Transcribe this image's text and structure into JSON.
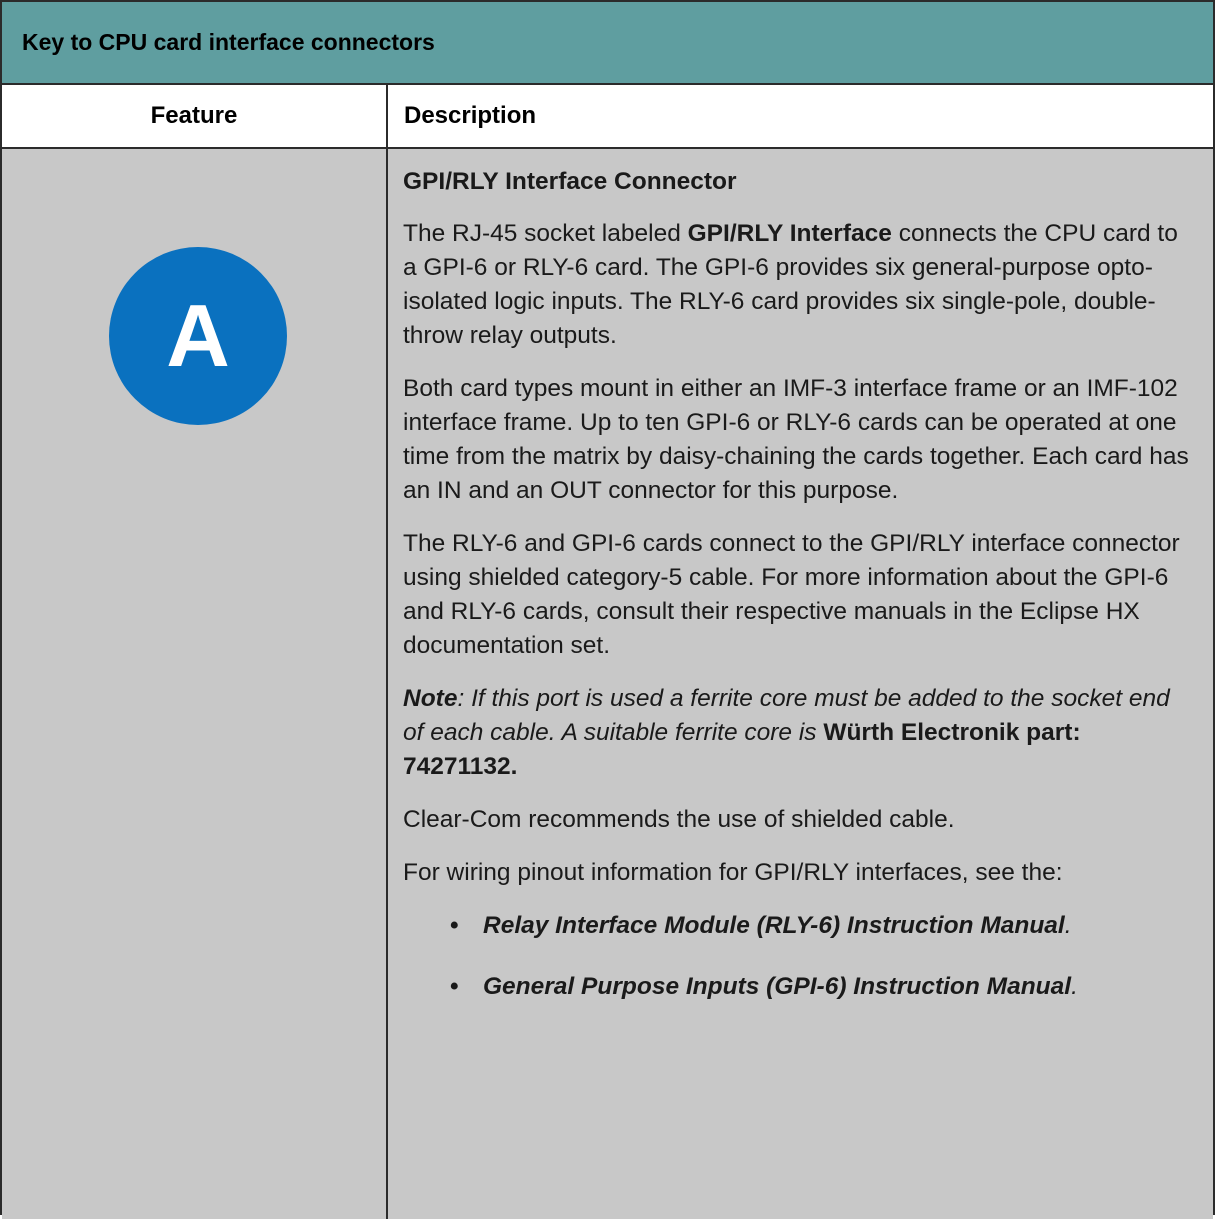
{
  "table": {
    "caption": "Key to CPU card interface connectors",
    "headers": {
      "feature": "Feature",
      "description": "Description"
    }
  },
  "row": {
    "feature_badge": "A",
    "title": "GPI/RLY Interface Connector",
    "p1": {
      "before": "The RJ-45 socket labeled ",
      "bold": "GPI/RLY Interface",
      "after": " connects the CPU card to a GPI-6 or RLY-6 card. The GPI-6 provides six general-purpose opto-isolated logic inputs. The RLY-6 card provides six single-pole, double-throw relay outputs."
    },
    "p2": "Both card types mount in either an IMF-3 interface frame or an IMF-102 interface frame. Up to ten GPI-6 or RLY-6 cards can be operated at one time from the matrix by daisy-chaining the cards together. Each card has an IN and an OUT connector for this purpose.",
    "p3": "The RLY-6 and GPI-6 cards connect to the GPI/RLY interface connector using shielded category-5 cable. For more information about the GPI-6 and RLY-6 cards, consult their respective manuals in the Eclipse HX documentation set.",
    "note": {
      "label": "Note",
      "text": ": If this port is used a ferrite core must be added to the socket end of each cable. A suitable ferrite core is ",
      "part": "Würth Electronik part: 74271132."
    },
    "p4": "Clear-Com recommends the use of shielded cable.",
    "p5": "For wiring pinout information for GPI/RLY interfaces, see the:",
    "references": [
      {
        "bullet": "•",
        "title": "Relay Interface Module (RLY-6) Instruction Manual",
        "suffix": "."
      },
      {
        "bullet": "•",
        "title": "General Purpose Inputs (GPI-6) Instruction Manual",
        "suffix": "."
      }
    ]
  },
  "colors": {
    "caption_bg": "#5f9ea0",
    "body_bg": "#c8c8c8",
    "badge_bg": "#0a71bf",
    "border": "#2b2b2b"
  }
}
